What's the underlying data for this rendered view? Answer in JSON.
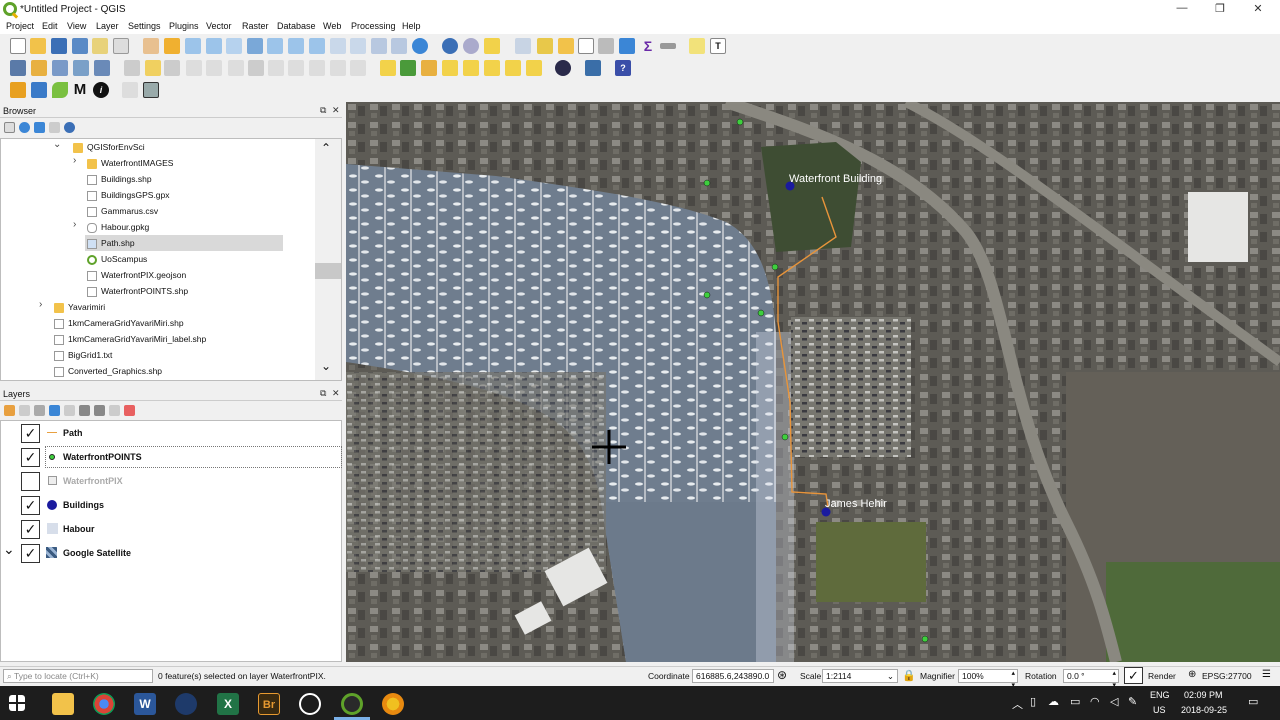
{
  "window": {
    "title": "*Untitled Project - QGIS"
  },
  "menu": [
    "Project",
    "Edit",
    "View",
    "Layer",
    "Settings",
    "Plugins",
    "Vector",
    "Raster",
    "Database",
    "Web",
    "Processing",
    "Help"
  ],
  "browser": {
    "title": "Browser",
    "items": [
      {
        "label": "QGISforEnvSci",
        "type": "folder",
        "indent": 0,
        "expanded": true
      },
      {
        "label": "WaterfrontIMAGES",
        "type": "folder",
        "indent": 1,
        "expanded": false
      },
      {
        "label": "Buildings.shp",
        "type": "file",
        "indent": 1
      },
      {
        "label": "BuildingsGPS.gpx",
        "type": "file",
        "indent": 1
      },
      {
        "label": "Gammarus.csv",
        "type": "file",
        "indent": 1
      },
      {
        "label": "Habour.gpkg",
        "type": "db",
        "indent": 1,
        "expanded": false
      },
      {
        "label": "Path.shp",
        "type": "file",
        "indent": 1,
        "selected": true
      },
      {
        "label": "UoScampus",
        "type": "qgs",
        "indent": 1
      },
      {
        "label": "WaterfrontPIX.geojson",
        "type": "file",
        "indent": 1
      },
      {
        "label": "WaterfrontPOINTS.shp",
        "type": "file",
        "indent": 1
      },
      {
        "label": "Yavarimiri",
        "type": "folder",
        "indent": -1,
        "expanded": false
      },
      {
        "label": "1kmCameraGridYavariMiri.shp",
        "type": "file",
        "indent": -1
      },
      {
        "label": "1kmCameraGridYavariMiri_label.shp",
        "type": "file",
        "indent": -1
      },
      {
        "label": "BigGrid1.txt",
        "type": "file",
        "indent": -1
      },
      {
        "label": "Converted_Graphics.shp",
        "type": "file",
        "indent": -1
      }
    ]
  },
  "layers": {
    "title": "Layers",
    "items": [
      {
        "label": "Path",
        "checked": true,
        "symbol": "line",
        "color": "#e8a040"
      },
      {
        "label": "WaterfrontPOINTS",
        "checked": true,
        "symbol": "dot",
        "color": "#3ecf3e",
        "active": true
      },
      {
        "label": "WaterfrontPIX",
        "checked": false,
        "symbol": "raster",
        "color": "#9a9a9a",
        "greyed": true
      },
      {
        "label": "Buildings",
        "checked": true,
        "symbol": "bigdot",
        "color": "#1a1a9e"
      },
      {
        "label": "Habour",
        "checked": true,
        "symbol": "fill",
        "color": "#d7deea"
      },
      {
        "label": "Google Satellite",
        "checked": true,
        "symbol": "tile",
        "color": "#3a5a80"
      }
    ]
  },
  "map": {
    "labels": [
      "Waterfront Building",
      "James Hehir"
    ],
    "colors": {
      "water": "#6f7d8e",
      "land": "#6a6861",
      "path": "#e8943a",
      "point": "#3ecf3e",
      "building": "#1a1a9e"
    }
  },
  "status": {
    "locate_placeholder": "Type to locate (Ctrl+K)",
    "message": "0 feature(s) selected on layer WaterfrontPIX.",
    "coordinate_label": "Coordinate",
    "coordinate": "616885.6,243890.0",
    "scale_label": "Scale",
    "scale": "1:2114",
    "magnifier_label": "Magnifier",
    "magnifier": "100%",
    "rotation_label": "Rotation",
    "rotation": "0.0 °",
    "render_label": "Render",
    "crs": "EPSG:27700"
  },
  "taskbar": {
    "lang": "ENG",
    "region": "US",
    "time": "02:09 PM",
    "date": "2018-09-25"
  }
}
